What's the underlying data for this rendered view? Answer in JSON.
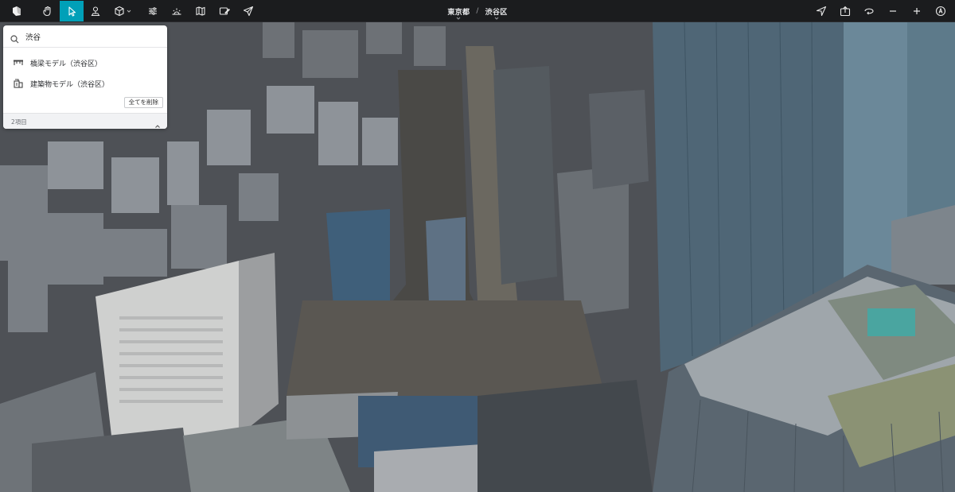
{
  "toolbar": {
    "logo_icon": "app-logo-icon",
    "tools": [
      {
        "name": "hand-tool",
        "icon": "hand-icon"
      },
      {
        "name": "select-tool",
        "icon": "cursor-arrow-icon",
        "active": true
      },
      {
        "name": "pin-tool",
        "icon": "pin-icon"
      },
      {
        "name": "3d-object-tool",
        "icon": "cube-icon"
      },
      {
        "name": "layers-tool",
        "icon": "sliders-icon"
      },
      {
        "name": "sun-tool",
        "icon": "sunrise-icon"
      },
      {
        "name": "map-tool",
        "icon": "map-icon"
      },
      {
        "name": "sketch-tool",
        "icon": "pencil-box-icon"
      },
      {
        "name": "share-tool",
        "icon": "send-icon"
      }
    ],
    "right_tools": [
      "location-arrow-icon",
      "export-icon",
      "rotate-icon",
      "zoom-out-icon",
      "zoom-in-icon",
      "account-icon"
    ],
    "accent_color": "#00a0b8"
  },
  "breadcrumb": {
    "prefecture": "東京都",
    "separator": "/",
    "ward": "渋谷区"
  },
  "search": {
    "query": "渋谷",
    "results": [
      {
        "label": "橋梁モデル（渋谷区）",
        "icon": "bridge-icon"
      },
      {
        "label": "建築物モデル（渋谷区）",
        "icon": "building-icon"
      }
    ],
    "clear_all_label": "全てを削除",
    "count_label": "2項目"
  }
}
